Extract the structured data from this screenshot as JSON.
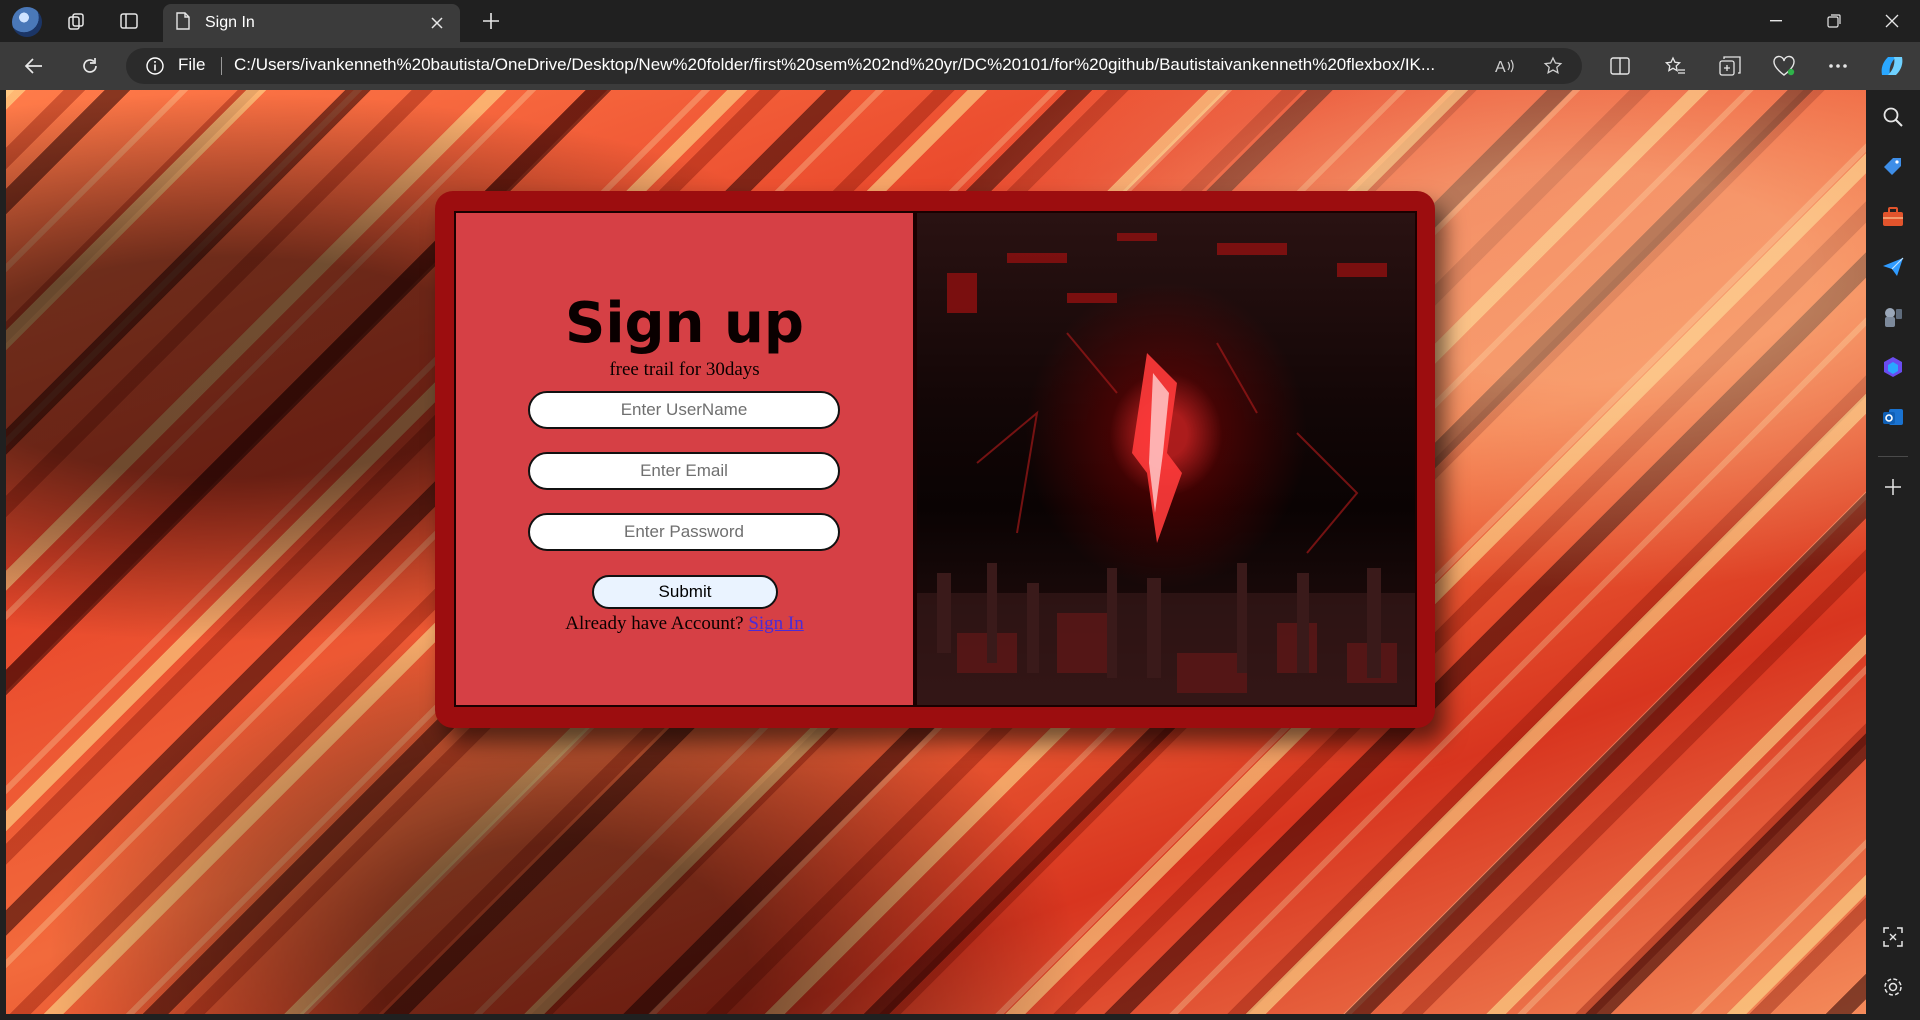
{
  "browser": {
    "tab_title": "Sign In",
    "address_scheme": "File",
    "url": "C:/Users/ivankenneth%20bautista/OneDrive/Desktop/New%20folder/first%20sem%202nd%20yr/DC%20101/for%20github/Bautistaivankenneth%20flexbox/IK..."
  },
  "icons": {
    "profile": "profile-avatar",
    "workspaces": "workspaces-icon",
    "tab_actions": "tab-actions-icon",
    "page": "page-icon",
    "close": "close-icon",
    "new_tab": "plus-icon",
    "back": "back-arrow-icon",
    "refresh": "refresh-icon",
    "info": "info-icon",
    "read_aloud": "read-aloud-icon",
    "favorite": "star-icon",
    "split_screen": "split-screen-icon",
    "favorites": "favorites-icon",
    "collections": "collections-icon",
    "health": "browser-essentials-icon",
    "more": "more-icon",
    "copilot": "copilot-icon"
  },
  "sidebar": {
    "items": [
      "search-icon",
      "shopping-tag-icon",
      "tools-icon",
      "send-icon",
      "games-icon",
      "office-icon",
      "outlook-icon",
      "add-icon",
      "screenshot-icon",
      "settings-icon"
    ]
  },
  "form": {
    "heading": "Sign up",
    "subtext": "free trail for 30days",
    "username_placeholder": "Enter UserName",
    "email_placeholder": "Enter Email",
    "password_placeholder": "Enter Password",
    "submit_label": "Submit",
    "already_text": "Already have Account?",
    "signin_link": "Sign In"
  },
  "colors": {
    "card_border": "#9c0d0f",
    "form_panel": "#d64045",
    "link": "#4b2bd6",
    "button_bg": "#eaf3ff"
  }
}
